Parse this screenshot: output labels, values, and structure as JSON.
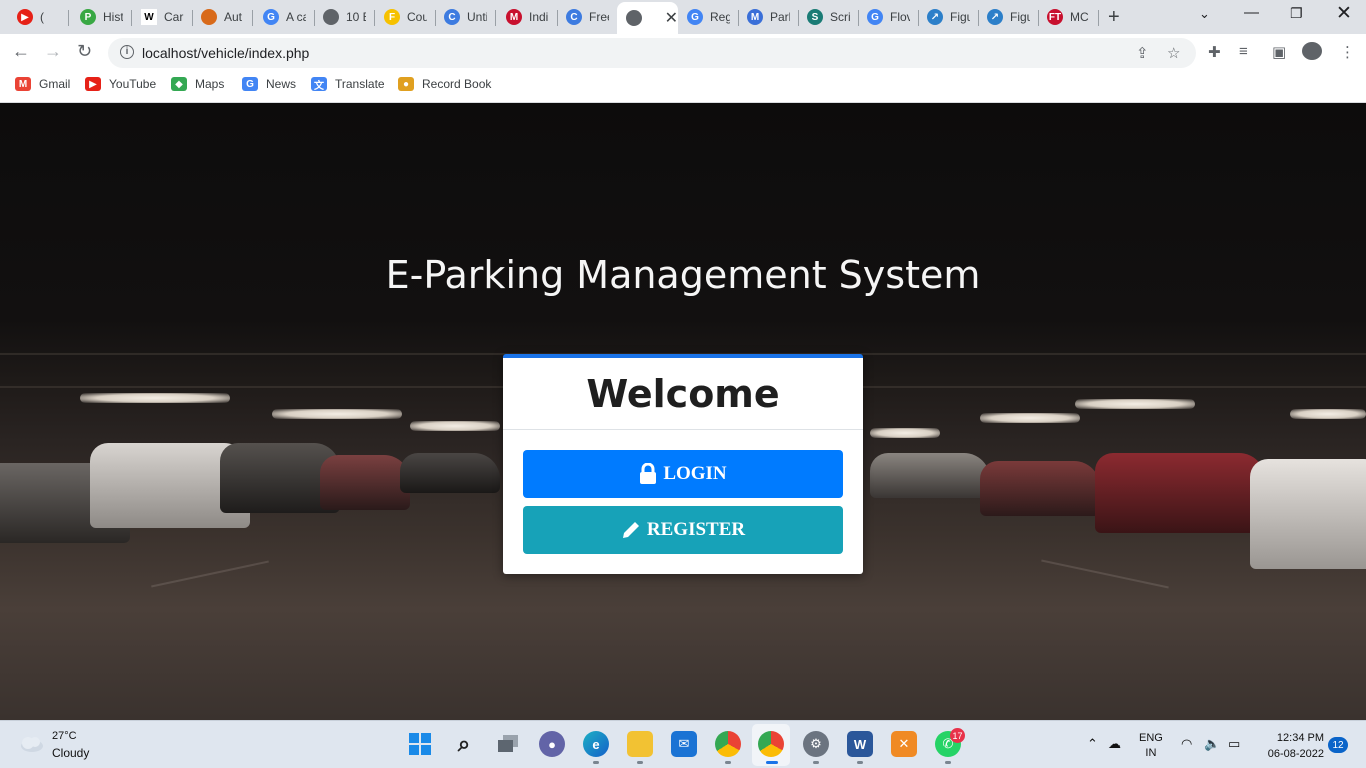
{
  "browser": {
    "tabs": [
      {
        "title": "(",
        "favicon": "youtube-icon",
        "color": "#e62117",
        "letter": "▶"
      },
      {
        "title": "Hist",
        "favicon": "history-icon",
        "color": "#39a844",
        "letter": "P"
      },
      {
        "title": "Car",
        "favicon": "wikipedia-icon",
        "color": "#ffffff",
        "letter": "W"
      },
      {
        "title": "Aut",
        "favicon": "globe-icon",
        "color": "#d86a1a",
        "letter": ""
      },
      {
        "title": "A ca",
        "favicon": "google-icon",
        "color": "#4285f4",
        "letter": "G"
      },
      {
        "title": "10 E",
        "favicon": "globe-icon",
        "color": "#5f6368",
        "letter": ""
      },
      {
        "title": "Cou",
        "favicon": "course-icon",
        "color": "#f6c100",
        "letter": "F"
      },
      {
        "title": "Unti",
        "favicon": "canva-icon",
        "color": "#3d7be0",
        "letter": "C"
      },
      {
        "title": "Indi",
        "favicon": "indiamart-icon",
        "color": "#c8102e",
        "letter": "M"
      },
      {
        "title": "Free",
        "favicon": "canva-icon",
        "color": "#3d7be0",
        "letter": "C"
      },
      {
        "title": "",
        "favicon": "globe-icon",
        "color": "#5f6368",
        "letter": ""
      },
      {
        "title": "Reg",
        "favicon": "google-icon",
        "color": "#4285f4",
        "letter": "G"
      },
      {
        "title": "Park",
        "favicon": "m-icon",
        "color": "#3a6fd8",
        "letter": "M"
      },
      {
        "title": "Scri",
        "favicon": "scribd-icon",
        "color": "#1a7b75",
        "letter": "S"
      },
      {
        "title": "Flov",
        "favicon": "google-icon",
        "color": "#4285f4",
        "letter": "G"
      },
      {
        "title": "Figu",
        "favicon": "figure-icon",
        "color": "#2c7fc9",
        "letter": "↗"
      },
      {
        "title": "Figu",
        "favicon": "figure-icon",
        "color": "#2c7fc9",
        "letter": "↗"
      },
      {
        "title": "MC",
        "favicon": "ft-icon",
        "color": "#c8102e",
        "letter": "FT"
      }
    ],
    "active_tab_index": 10,
    "address": "localhost/vehicle/index.php",
    "bookmarks": [
      {
        "label": "Gmail",
        "icon": "gmail-icon",
        "color": "#ea4335",
        "letter": "M"
      },
      {
        "label": "YouTube",
        "icon": "youtube-icon",
        "color": "#e62117",
        "letter": "▶"
      },
      {
        "label": "Maps",
        "icon": "maps-icon",
        "color": "#34a853",
        "letter": "◆"
      },
      {
        "label": "News",
        "icon": "news-icon",
        "color": "#4285f4",
        "letter": "G"
      },
      {
        "label": "Translate",
        "icon": "translate-icon",
        "color": "#4285f4",
        "letter": "文"
      },
      {
        "label": "Record Book",
        "icon": "recordbook-icon",
        "color": "#e0a020",
        "letter": "●"
      }
    ]
  },
  "page": {
    "title": "E-Parking Management System",
    "card": {
      "heading": "Welcome",
      "login_label": "LOGIN",
      "register_label": "REGISTER"
    },
    "colors": {
      "accent": "#1a73e8",
      "login": "#007bff",
      "register": "#17a2b8"
    }
  },
  "taskbar": {
    "weather_temp": "27°C",
    "weather_cond": "Cloudy",
    "whatsapp_badge": "17",
    "lang_line1": "ENG",
    "lang_line2": "IN",
    "time": "12:34 PM",
    "date": "06-08-2022",
    "notifications": "12"
  }
}
